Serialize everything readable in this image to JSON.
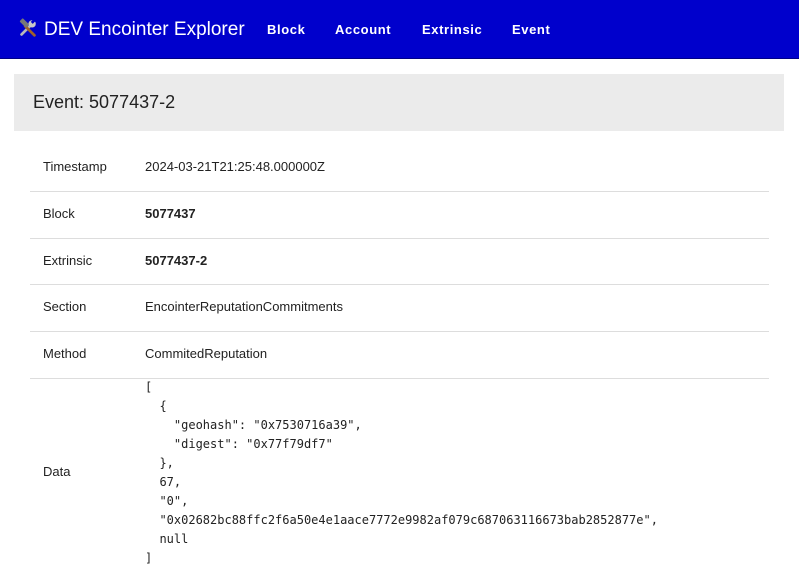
{
  "navbar": {
    "brand": "DEV Encointer Explorer",
    "brand_icon": "hammer-and-wrench-icon",
    "links": [
      "Block",
      "Account",
      "Extrinsic",
      "Event"
    ],
    "background": "#0000cc"
  },
  "page": {
    "title": "Event: 5077437-2"
  },
  "details": [
    {
      "label": "Timestamp",
      "value": "2024-03-21T21:25:48.000000Z"
    },
    {
      "label": "Block",
      "value": "5077437"
    },
    {
      "label": "Extrinsic",
      "value": "5077437-2"
    },
    {
      "label": "Section",
      "value": "EncointerReputationCommitments"
    },
    {
      "label": "Method",
      "value": "CommitedReputation"
    },
    {
      "label": "Data",
      "value": "[\n  {\n    \"geohash\": \"0x7530716a39\",\n    \"digest\": \"0x77f79df7\"\n  },\n  67,\n  \"0\",\n  \"0x02682bc88ffc2f6a50e4e1aace7772e9982af079c687063116673bab2852877e\",\n  null\n]"
    }
  ]
}
